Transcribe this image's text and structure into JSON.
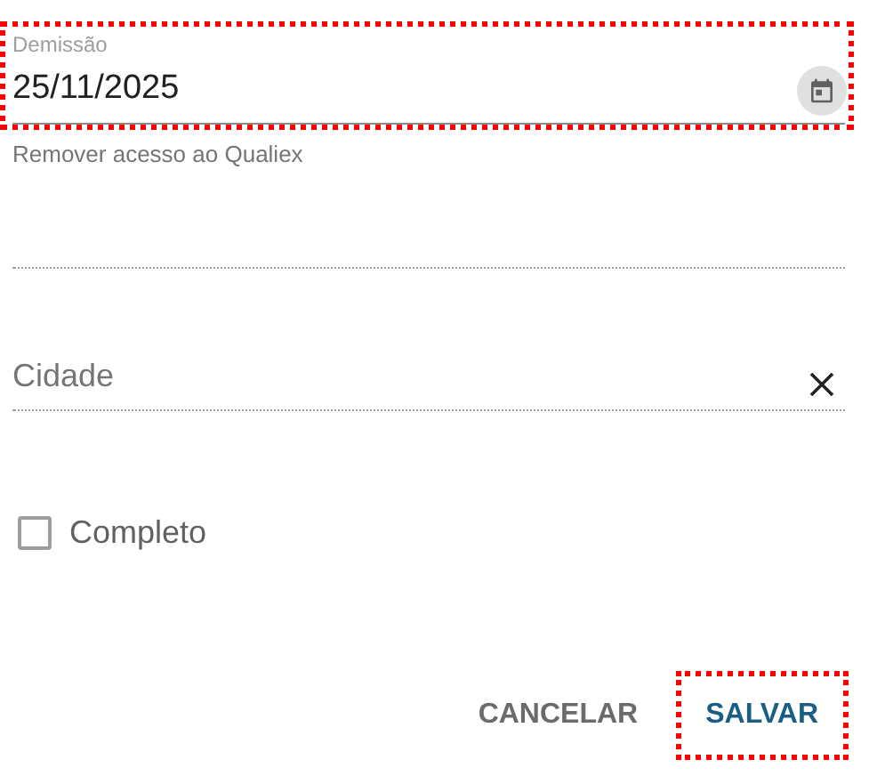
{
  "fields": [
    {
      "kind": "date",
      "label": "Demissão",
      "value": "25/11/2025",
      "hint": "Remover acesso ao Qualiex",
      "disabled": false,
      "highlighted": true
    },
    {
      "kind": "blank",
      "disabled": true,
      "highlighted": false
    },
    {
      "kind": "clearable",
      "placeholder": "Cidade",
      "disabled": true,
      "highlighted": false
    }
  ],
  "checkbox": {
    "label": "Completo",
    "checked": false
  },
  "buttons": [
    {
      "label": "CANCELAR",
      "kind": "secondary",
      "highlighted": false
    },
    {
      "label": "SALVAR",
      "kind": "primary",
      "highlighted": true
    }
  ]
}
